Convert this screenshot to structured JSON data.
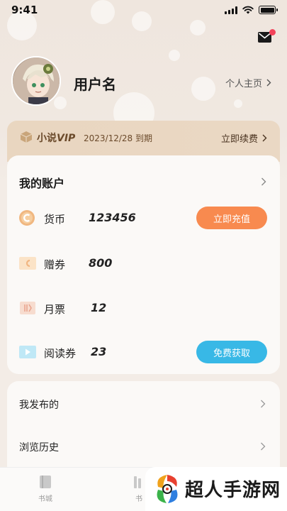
{
  "status_bar": {
    "time": "9:41"
  },
  "profile": {
    "username": "用户名",
    "homepage_link": "个人主页"
  },
  "vip": {
    "title_prefix": "小说",
    "title_suffix": "VIP",
    "expiry": "2023/12/28 到期",
    "renew_label": "立即续费"
  },
  "account": {
    "title": "我的账户",
    "rows": [
      {
        "label": "货币",
        "value": "123456",
        "icon": "currency-coin-icon",
        "action": "立即充值"
      },
      {
        "label": "赠券",
        "value": "800",
        "icon": "gift-coupon-icon"
      },
      {
        "label": "月票",
        "value": "12",
        "icon": "monthly-ticket-icon"
      },
      {
        "label": "阅读券",
        "value": "23",
        "icon": "reading-voucher-icon",
        "action": "免费获取"
      }
    ]
  },
  "menu": {
    "items": [
      {
        "label": "我发布的"
      },
      {
        "label": "浏览历史"
      }
    ]
  },
  "bottom_nav": {
    "items": [
      {
        "label": "书城"
      },
      {
        "label": "书"
      }
    ]
  },
  "watermark": {
    "text": "超人手游网"
  },
  "colors": {
    "accent_orange": "#f88a4f",
    "accent_blue": "#38b8e6",
    "vip_bg": "#e9d6c0",
    "badge_red": "#f2435a"
  }
}
